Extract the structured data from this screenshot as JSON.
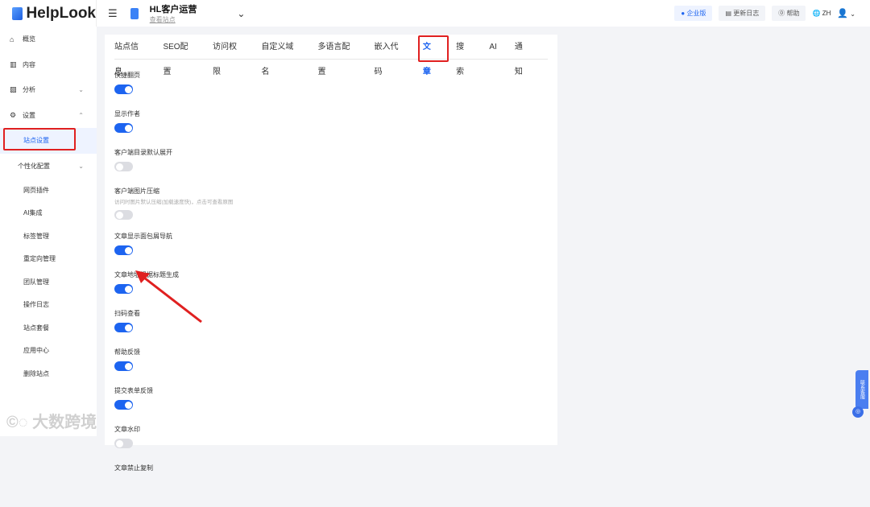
{
  "header": {
    "logo": "HelpLook",
    "site_title": "HL客户运营",
    "site_link": "查看站点",
    "enterprise": "企业版",
    "changelog": "更新日志",
    "help": "帮助",
    "lang": "ZH"
  },
  "sidebar": {
    "items": [
      {
        "label": "概览",
        "icon": "home-icon"
      },
      {
        "label": "内容",
        "icon": "book-icon"
      },
      {
        "label": "分析",
        "icon": "chart-icon"
      },
      {
        "label": "设置",
        "icon": "gear-icon"
      },
      {
        "label": "站点设置"
      },
      {
        "label": "个性化配置"
      },
      {
        "label": "网页插件"
      },
      {
        "label": "AI集成"
      },
      {
        "label": "标签管理"
      },
      {
        "label": "重定向管理"
      },
      {
        "label": "团队管理"
      },
      {
        "label": "操作日志"
      },
      {
        "label": "站点套餐"
      },
      {
        "label": "应用中心"
      },
      {
        "label": "删除站点"
      }
    ]
  },
  "tabs": [
    "站点信息",
    "SEO配置",
    "访问权限",
    "自定义域名",
    "多语言配置",
    "嵌入代码",
    "文章",
    "搜索",
    "AI",
    "通知"
  ],
  "active_tab": "文章",
  "settings": [
    {
      "label": "快捷翻页",
      "on": true
    },
    {
      "label": "显示作者",
      "on": true
    },
    {
      "label": "客户端目录默认展开",
      "on": false
    },
    {
      "label": "客户端图片压缩",
      "desc": "访问时图片默认压缩(加载速度快)，点击可查看原图",
      "on": false
    },
    {
      "label": "文章显示面包屑导航",
      "on": true
    },
    {
      "label": "文章地址根据标题生成",
      "on": true
    },
    {
      "label": "扫码查看",
      "on": true
    },
    {
      "label": "帮助反馈",
      "on": true
    },
    {
      "label": "提交表单反馈",
      "on": true
    },
    {
      "label": "文章水印",
      "on": false
    },
    {
      "label": "文章禁止复制"
    }
  ],
  "float": {
    "label": "联系客服"
  },
  "watermark": "大数跨境"
}
